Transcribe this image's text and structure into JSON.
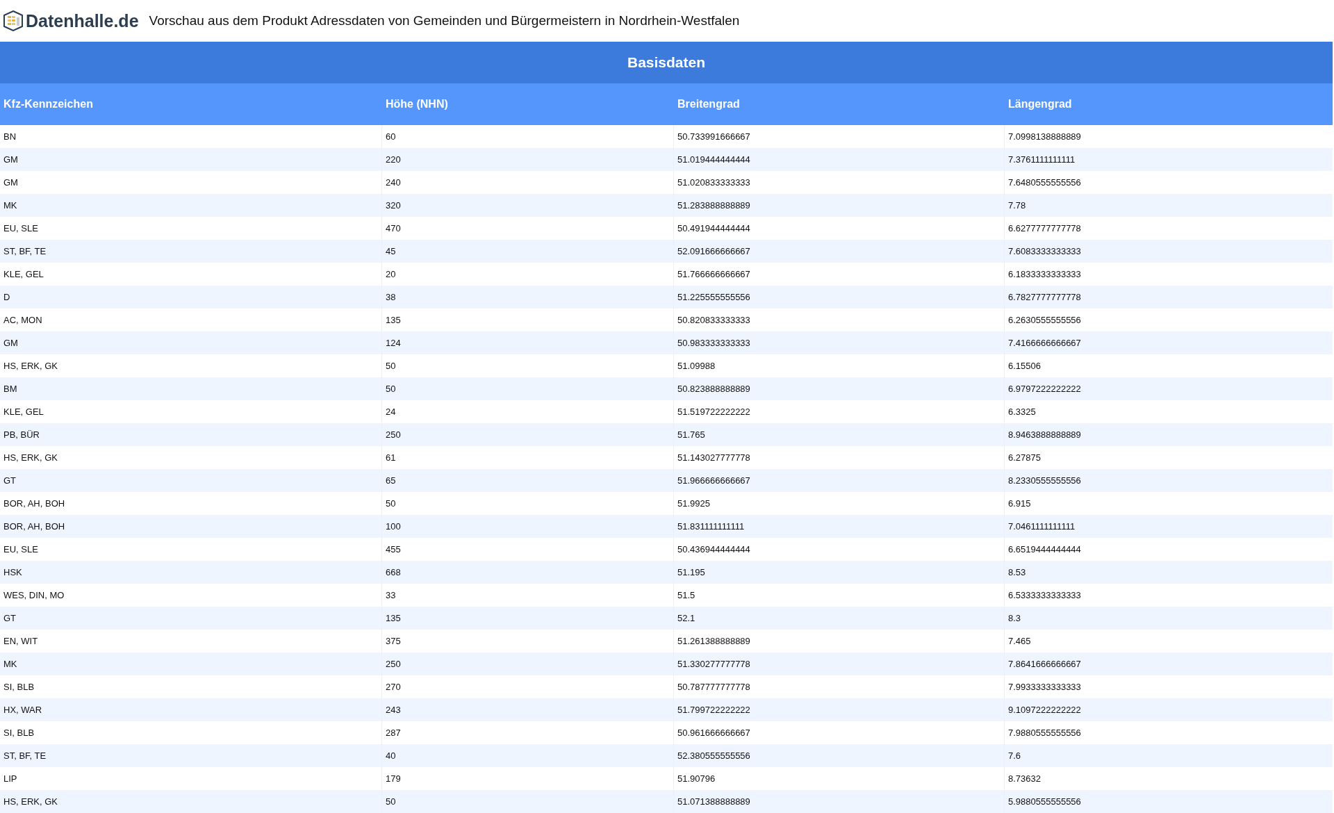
{
  "header": {
    "logo_text": "Datenhalle.de",
    "title": "Vorschau aus dem Produkt Adressdaten von Gemeinden und Bürgermeistern in Nordrhein-Westfalen"
  },
  "table": {
    "group_title": "Basisdaten",
    "columns": [
      "Kfz-Kennzeichen",
      "Höhe (NHN)",
      "Breitengrad",
      "Längengrad"
    ],
    "rows": [
      [
        "BN",
        "60",
        "50.733991666667",
        "7.0998138888889"
      ],
      [
        "GM",
        "220",
        "51.019444444444",
        "7.3761111111111"
      ],
      [
        "GM",
        "240",
        "51.020833333333",
        "7.6480555555556"
      ],
      [
        "MK",
        "320",
        "51.283888888889",
        "7.78"
      ],
      [
        "EU, SLE",
        "470",
        "50.491944444444",
        "6.6277777777778"
      ],
      [
        "ST, BF, TE",
        "45",
        "52.091666666667",
        "7.6083333333333"
      ],
      [
        "KLE, GEL",
        "20",
        "51.766666666667",
        "6.1833333333333"
      ],
      [
        "D",
        "38",
        "51.225555555556",
        "6.7827777777778"
      ],
      [
        "AC, MON",
        "135",
        "50.820833333333",
        "6.2630555555556"
      ],
      [
        "GM",
        "124",
        "50.983333333333",
        "7.4166666666667"
      ],
      [
        "HS, ERK, GK",
        "50",
        "51.09988",
        "6.15506"
      ],
      [
        "BM",
        "50",
        "50.823888888889",
        "6.9797222222222"
      ],
      [
        "KLE, GEL",
        "24",
        "51.519722222222",
        "6.3325"
      ],
      [
        "PB, BÜR",
        "250",
        "51.765",
        "8.9463888888889"
      ],
      [
        "HS, ERK, GK",
        "61",
        "51.143027777778",
        "6.27875"
      ],
      [
        "GT",
        "65",
        "51.966666666667",
        "8.2330555555556"
      ],
      [
        "BOR, AH, BOH",
        "50",
        "51.9925",
        "6.915"
      ],
      [
        "BOR, AH, BOH",
        "100",
        "51.831111111111",
        "7.0461111111111"
      ],
      [
        "EU, SLE",
        "455",
        "50.436944444444",
        "6.6519444444444"
      ],
      [
        "HSK",
        "668",
        "51.195",
        "8.53"
      ],
      [
        "WES, DIN, MO",
        "33",
        "51.5",
        "6.5333333333333"
      ],
      [
        "GT",
        "135",
        "52.1",
        "8.3"
      ],
      [
        "EN, WIT",
        "375",
        "51.261388888889",
        "7.465"
      ],
      [
        "MK",
        "250",
        "51.330277777778",
        "7.8641666666667"
      ],
      [
        "SI, BLB",
        "270",
        "50.787777777778",
        "7.9933333333333"
      ],
      [
        "HX, WAR",
        "243",
        "51.799722222222",
        "9.1097222222222"
      ],
      [
        "SI, BLB",
        "287",
        "50.961666666667",
        "7.9880555555556"
      ],
      [
        "ST, BF, TE",
        "40",
        "52.380555555556",
        "7.6"
      ],
      [
        "LIP",
        "179",
        "51.90796",
        "8.73632"
      ],
      [
        "HS, ERK, GK",
        "50",
        "51.071388888889",
        "5.9880555555556"
      ]
    ]
  }
}
